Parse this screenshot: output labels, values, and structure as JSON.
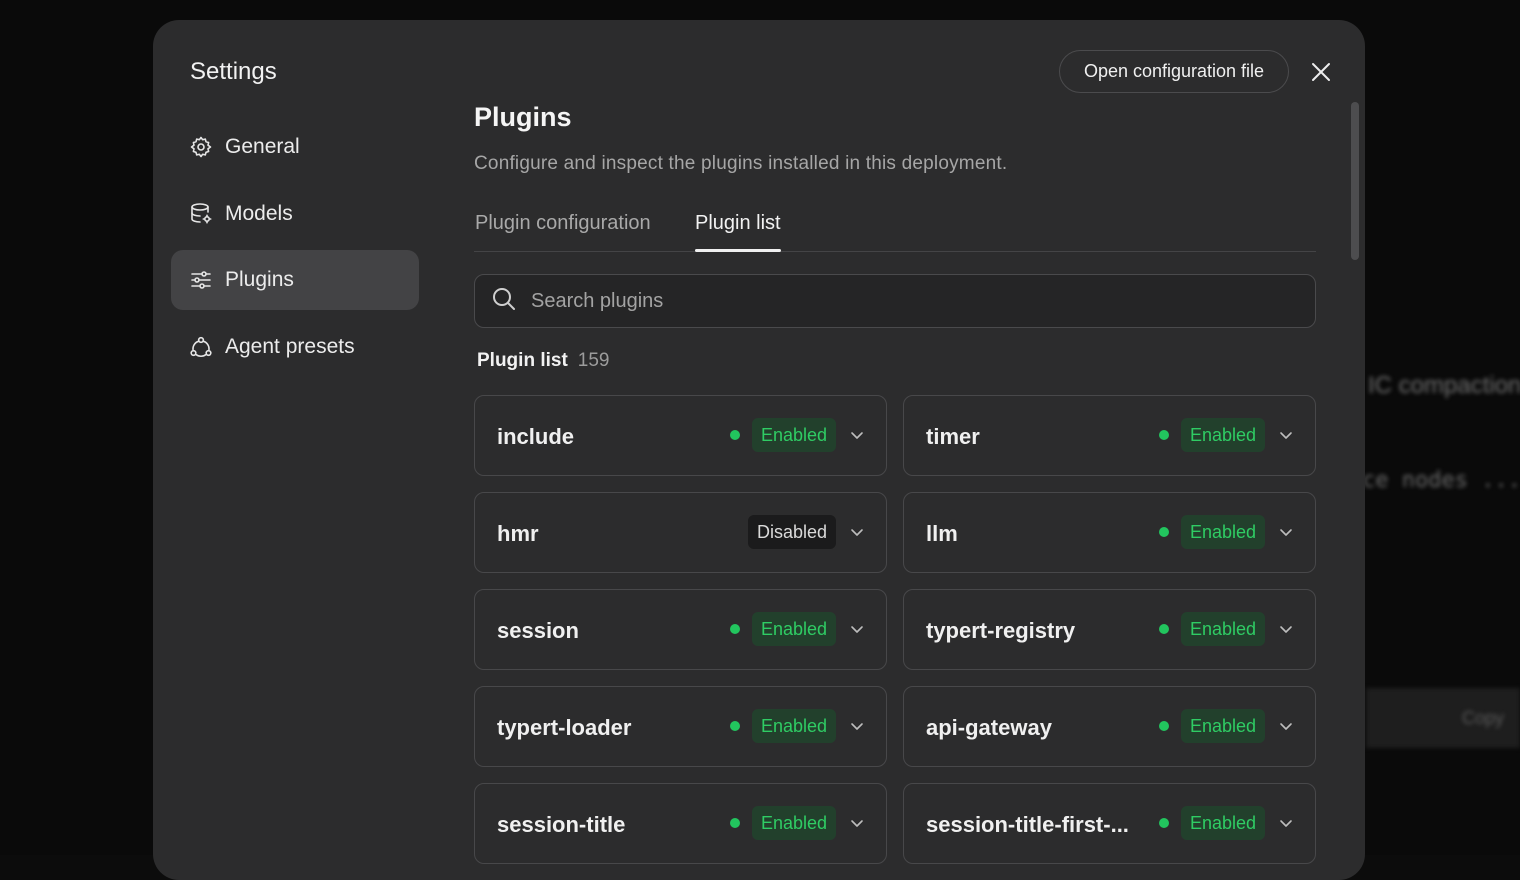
{
  "background": {
    "text1": "IC compaction",
    "text2": "ce nodes ...",
    "text3": "Copy"
  },
  "modal": {
    "title": "Settings",
    "open_config_label": "Open configuration file"
  },
  "sidebar": {
    "items": [
      {
        "label": "General",
        "icon": "gear-icon",
        "active": false
      },
      {
        "label": "Models",
        "icon": "database-icon",
        "active": false
      },
      {
        "label": "Plugins",
        "icon": "sliders-icon",
        "active": true
      },
      {
        "label": "Agent presets",
        "icon": "agents-icon",
        "active": false
      }
    ]
  },
  "main": {
    "title": "Plugins",
    "description": "Configure and inspect the plugins installed in this deployment.",
    "tabs": [
      {
        "label": "Plugin configuration",
        "active": false
      },
      {
        "label": "Plugin list",
        "active": true
      }
    ],
    "search": {
      "placeholder": "Search plugins",
      "value": ""
    },
    "list_title": "Plugin list",
    "list_count": "159",
    "plugins": [
      {
        "name": "include",
        "status": "Enabled"
      },
      {
        "name": "timer",
        "status": "Enabled"
      },
      {
        "name": "hmr",
        "status": "Disabled"
      },
      {
        "name": "llm",
        "status": "Enabled"
      },
      {
        "name": "session",
        "status": "Enabled"
      },
      {
        "name": "typert-registry",
        "status": "Enabled"
      },
      {
        "name": "typert-loader",
        "status": "Enabled"
      },
      {
        "name": "api-gateway",
        "status": "Enabled"
      },
      {
        "name": "session-title",
        "status": "Enabled"
      },
      {
        "name": "session-title-first-...",
        "status": "Enabled"
      }
    ]
  },
  "colors": {
    "enabled_text": "#2fcc64",
    "enabled_dot": "#22c55e",
    "enabled_bg": "#22402c",
    "modal_bg": "#2c2c2d"
  }
}
